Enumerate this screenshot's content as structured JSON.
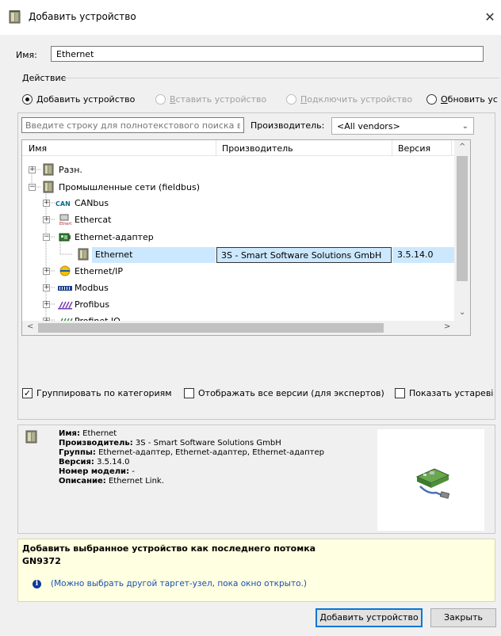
{
  "window": {
    "title": "Добавить устройство"
  },
  "name": {
    "label": "Имя:",
    "value": "Ethernet"
  },
  "action": {
    "label": "Действие",
    "options": [
      {
        "label": "Добавить устройство",
        "mnemonic": "Д",
        "rest": "обавить устройство",
        "selected": true,
        "enabled": true
      },
      {
        "label": "Вставить устройство",
        "mnemonic": "В",
        "rest": "ставить устройство",
        "selected": false,
        "enabled": false
      },
      {
        "label": "Подключить устройство",
        "mnemonic": "П",
        "rest": "одключить устройство",
        "selected": false,
        "enabled": false
      },
      {
        "label": "Обновить ус",
        "mnemonic": "О",
        "rest": "бновить ус",
        "selected": false,
        "enabled": true
      }
    ]
  },
  "search": {
    "placeholder": "Введите строку для полнотекстового поиска в"
  },
  "vendor": {
    "label": "Производитель:",
    "selected": "<All vendors>"
  },
  "tree": {
    "columns": [
      "Имя",
      "Производитель",
      "Версия"
    ],
    "rows": [
      {
        "name": "Разн.",
        "expander": "+"
      },
      {
        "name": "Промышленные сети (fieldbus)",
        "expander": "−"
      },
      {
        "name": "CANbus",
        "expander": "+"
      },
      {
        "name": "Ethercat",
        "expander": "+"
      },
      {
        "name": "Ethernet-адаптер",
        "expander": "−"
      },
      {
        "name": "Ethernet",
        "vendor": "3S - Smart Software Solutions GmbH",
        "version": "3.5.14.0",
        "selected": true
      },
      {
        "name": "Ethernet/IP",
        "expander": "+"
      },
      {
        "name": "Modbus",
        "expander": "+"
      },
      {
        "name": "Profibus",
        "expander": "+"
      },
      {
        "name": "Profinet IO",
        "expander": "+"
      }
    ]
  },
  "options": {
    "group_by_category": {
      "label": "Группировать по категориям",
      "checked": true
    },
    "show_all_versions": {
      "label": "Отображать все версии (для экспертов)",
      "checked": false
    },
    "show_outdated": {
      "label": "Показать устареві",
      "checked": false
    }
  },
  "info": {
    "name_label": "Имя:",
    "name_value": "Ethernet",
    "vendor_label": "Производитель:",
    "vendor_value": "3S - Smart Software Solutions GmbH",
    "groups_label": "Группы:",
    "groups_value": "Ethernet-адаптер, Ethernet-адаптер, Ethernet-адаптер",
    "version_label": "Версия:",
    "version_value": "3.5.14.0",
    "model_label": "Номер модели:",
    "model_value": "-",
    "description_label": "Описание:",
    "description_value": "Ethernet Link."
  },
  "hint": {
    "title": "Добавить выбранное устройство как последнего потомка",
    "target": "GN9372",
    "note": "(Можно выбрать другой таргет-узел, пока окно открыто.)"
  },
  "buttons": {
    "add": "Добавить устройство",
    "close": "Закрыть"
  }
}
